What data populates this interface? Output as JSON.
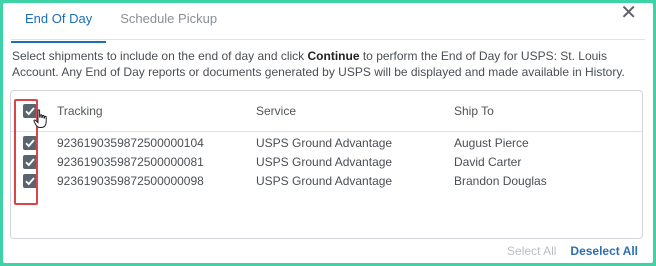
{
  "tabs": [
    {
      "label": "End Of Day",
      "active": true
    },
    {
      "label": "Schedule Pickup",
      "active": false
    }
  ],
  "close_label": "✕",
  "description": {
    "part1": "Select shipments to include on the end of day and click ",
    "bold": "Continue",
    "part2": " to perform the End of Day for USPS: St. Louis Account. Any End of Day reports or documents generated by USPS will be displayed and made available in History."
  },
  "table": {
    "columns": [
      "Tracking",
      "Service",
      "Ship To"
    ],
    "rows": [
      {
        "tracking": "9236190359872500000104",
        "service": "USPS Ground Advantage",
        "ship_to": "August Pierce",
        "checked": true
      },
      {
        "tracking": "9236190359872500000081",
        "service": "USPS Ground Advantage",
        "ship_to": "David Carter",
        "checked": true
      },
      {
        "tracking": "9236190359872500000098",
        "service": "USPS Ground Advantage",
        "ship_to": "Brandon Douglas",
        "checked": true
      }
    ]
  },
  "footer": {
    "select_all": "Select All",
    "deselect_all": "Deselect All"
  },
  "colors": {
    "background": "#3dd3a6",
    "accent": "#1b6fb5",
    "highlight": "#d6464b",
    "checkbox": "#5a6470"
  }
}
